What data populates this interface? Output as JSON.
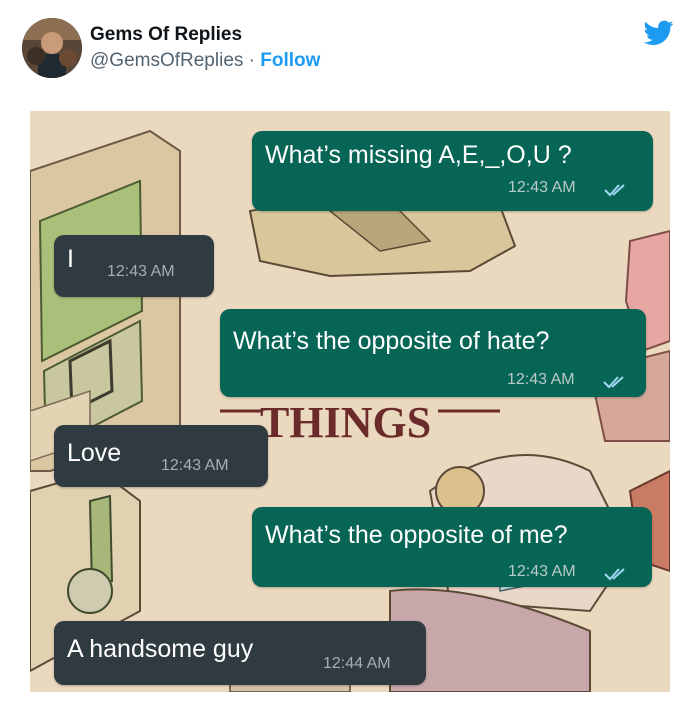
{
  "tweet": {
    "author_name": "Gems Of Replies",
    "handle": "@GemsOfReplies",
    "separator": " · ",
    "follow_label": "Follow",
    "brand_color": "#1d9bf0"
  },
  "chat": {
    "outgoing_color": "#076556",
    "incoming_color": "#2f3b40",
    "messages": [
      {
        "direction": "outgoing",
        "text": "What’s missing A,E,_,O,U ?",
        "time": "12:43 AM",
        "status": "read-ticks"
      },
      {
        "direction": "incoming",
        "text": "I",
        "time": "12:43 AM"
      },
      {
        "direction": "outgoing",
        "text": "What’s the opposite of hate?",
        "time": "12:43 AM",
        "status": "read-ticks"
      },
      {
        "direction": "incoming",
        "text": "Love",
        "time": "12:43 AM"
      },
      {
        "direction": "outgoing",
        "text": "What’s the opposite of me?",
        "time": "12:43 AM",
        "status": "read-ticks"
      },
      {
        "direction": "incoming",
        "text": "A handsome guy",
        "time": "12:44 AM"
      }
    ]
  },
  "background_art": {
    "title_fragment": "THINGS"
  }
}
